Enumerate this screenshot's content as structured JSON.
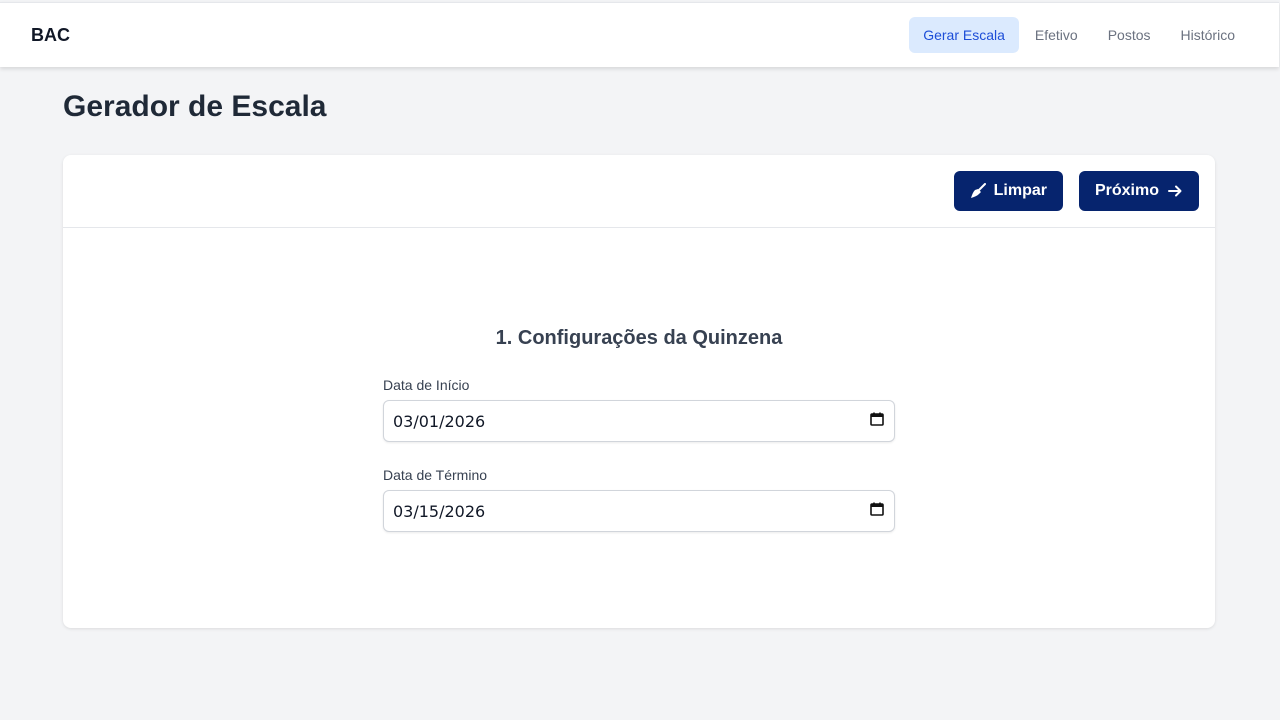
{
  "app": {
    "brand": "BAC"
  },
  "nav": {
    "items": [
      {
        "label": "Gerar Escala",
        "active": true
      },
      {
        "label": "Efetivo",
        "active": false
      },
      {
        "label": "Postos",
        "active": false
      },
      {
        "label": "Histórico",
        "active": false
      }
    ]
  },
  "page": {
    "title": "Gerador de Escala"
  },
  "toolbar": {
    "clear_label": "Limpar",
    "clear_icon": "broom-icon",
    "next_label": "Próximo",
    "next_icon": "arrow-right-icon"
  },
  "form": {
    "section_title": "1. Configurações da Quinzena",
    "start_label": "Data de Início",
    "start_value": "03/01/2026",
    "end_label": "Data de Término",
    "end_value": "03/15/2026",
    "date_icon": "calendar-icon"
  },
  "colors": {
    "primary": "#06246e",
    "nav_active_bg": "#dbeafe",
    "nav_active_text": "#1d4ed8",
    "background": "#f3f4f6"
  }
}
